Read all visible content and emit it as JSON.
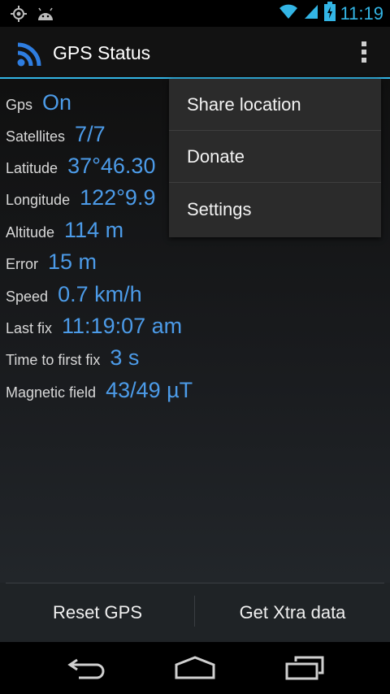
{
  "status_bar": {
    "time": "11:19",
    "icons": [
      "gps-icon",
      "android-icon",
      "wifi-icon",
      "signal-icon",
      "battery-charging-icon"
    ]
  },
  "action_bar": {
    "title": "GPS Status",
    "app_icon": "rss-signal-icon"
  },
  "fields": [
    {
      "label": "Gps",
      "value": "On"
    },
    {
      "label": "Satellites",
      "value": "7/7"
    },
    {
      "label": "Latitude",
      "value": "37°46.30"
    },
    {
      "label": "Longitude",
      "value": "122°9.9"
    },
    {
      "label": "Altitude",
      "value": "114 m"
    },
    {
      "label": "Error",
      "value": "15 m"
    },
    {
      "label": "Speed",
      "value": "0.7 km/h"
    },
    {
      "label": "Last fix",
      "value": "11:19:07 am"
    },
    {
      "label": "Time to first fix",
      "value": "3 s"
    },
    {
      "label": "Magnetic field",
      "value": "43/49 µT"
    }
  ],
  "menu": {
    "items": [
      "Share location",
      "Donate",
      "Settings"
    ]
  },
  "bottom_buttons": {
    "reset": "Reset GPS",
    "xtra": "Get Xtra data"
  },
  "colors": {
    "accent": "#33b5e5",
    "value_text": "#4c9be8"
  }
}
